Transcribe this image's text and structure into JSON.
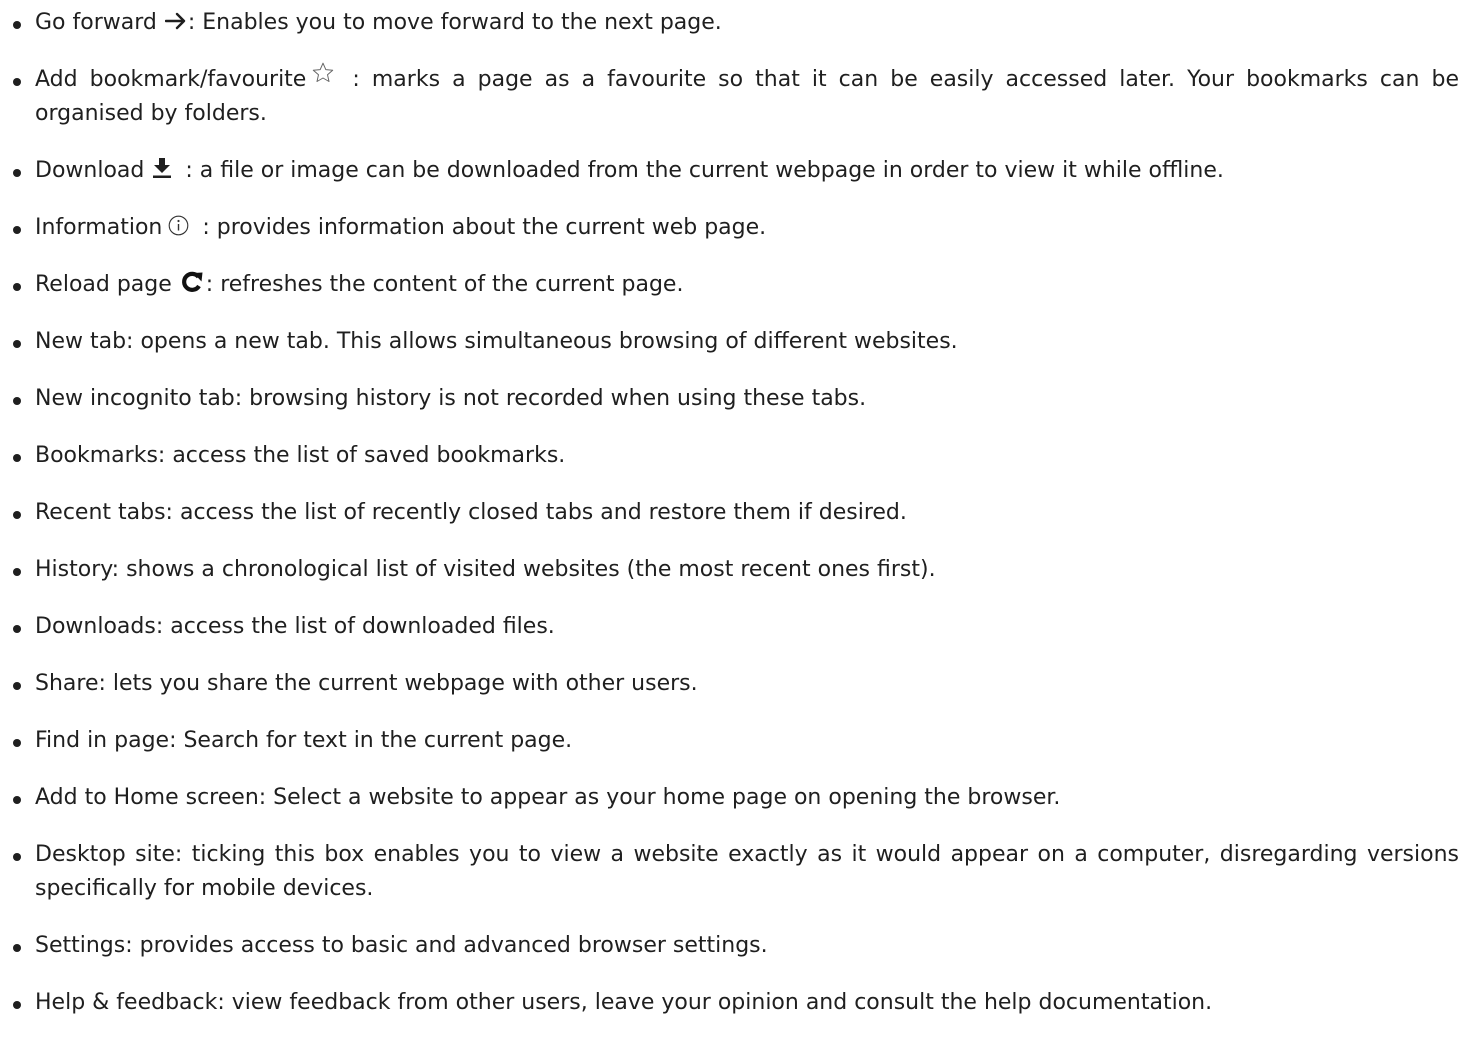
{
  "items": [
    {
      "label": "Go forward",
      "icon": "arrow-right-icon",
      "text": ": Enables you to move forward to the next page."
    },
    {
      "label": "Add bookmark/favourite",
      "icon": "star-outline-icon",
      "text": " : marks a page as a favourite so that it can be easily accessed later. Your bookmarks can be organised by folders."
    },
    {
      "label": "Download",
      "icon": "download-icon",
      "text": " : a file or image can be downloaded from the current webpage in order to view it while offline."
    },
    {
      "label": "Information",
      "icon": "info-circle-icon",
      "text": " : provides information about the current web page."
    },
    {
      "label": "Reload page",
      "icon": "reload-icon",
      "text": ": refreshes the content of the current page."
    },
    {
      "text": "New tab: opens a new tab. This allows simultaneous browsing of different websites."
    },
    {
      "text": "New incognito tab: browsing history is not recorded when using these tabs."
    },
    {
      "text": "Bookmarks: access the list of saved bookmarks."
    },
    {
      "text": "Recent tabs: access the list of recently closed tabs and restore them if desired."
    },
    {
      "text": "History: shows a chronological list of visited websites (the most recent ones first)."
    },
    {
      "text": "Downloads: access the list of downloaded files."
    },
    {
      "text": "Share: lets you share the current webpage with other users."
    },
    {
      "text": "Find in page: Search for text in the current page."
    },
    {
      "text": "Add to Home screen: Select a website to appear as your home page on opening the browser."
    },
    {
      "text": "Desktop site: ticking this box enables you to view a website exactly as it would appear on a computer, disregarding versions specifically for mobile devices."
    },
    {
      "text": "Settings: provides access to basic and advanced browser settings."
    },
    {
      "text": "Help & feedback: view feedback from other users, leave your opinion and consult the help documentation."
    }
  ]
}
